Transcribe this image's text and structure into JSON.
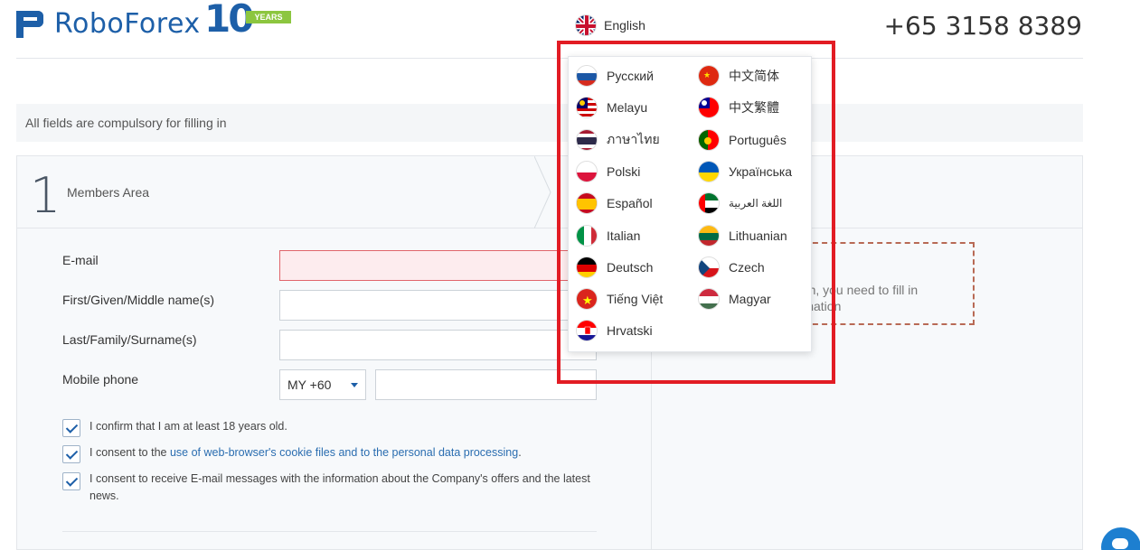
{
  "header": {
    "brand": "RoboForex",
    "anniversary_number": "10",
    "anniversary_label": "YEARS",
    "language_current": "English",
    "phone": "+65 3158 8389"
  },
  "notice": "All fields are compulsory for filling in",
  "step": {
    "number": "1",
    "label": "Members Area"
  },
  "form": {
    "email_label": "E-mail",
    "first_name_label": "First/Given/Middle name(s)",
    "last_name_label": "Last/Family/Surname(s)",
    "mobile_label": "Mobile phone",
    "country_code": "MY +60"
  },
  "checkboxes": [
    {
      "text": "I confirm that I am at least 18 years old.",
      "checked": true
    },
    {
      "prefix": "I consent to the ",
      "link": "use of web-browser's cookie files and to the personal data processing",
      "suffix": ".",
      "checked": true
    },
    {
      "text": "I consent to receive E-mail messages with the information about the Company's offers and the latest news.",
      "checked": true
    }
  ],
  "info": {
    "line1": "ation, you need to fill in",
    "line2": "formation"
  },
  "languages": [
    {
      "label": "Русский",
      "flag": "ru-flag-icon"
    },
    {
      "label": "中文简体",
      "flag": "cn-flag-icon"
    },
    {
      "label": "Melayu",
      "flag": "my-flag-icon"
    },
    {
      "label": "中文繁體",
      "flag": "tw-flag-icon"
    },
    {
      "label": "ภาษาไทย",
      "flag": "th-flag-icon"
    },
    {
      "label": "Português",
      "flag": "pt-flag-icon"
    },
    {
      "label": "Polski",
      "flag": "pl-flag-icon"
    },
    {
      "label": "Українська",
      "flag": "ua-flag-icon"
    },
    {
      "label": "Español",
      "flag": "es-flag-icon"
    },
    {
      "label": "اللغة العربية",
      "flag": "ae-flag-icon"
    },
    {
      "label": "Italian",
      "flag": "it-flag-icon"
    },
    {
      "label": "Lithuanian",
      "flag": "lt-flag-icon"
    },
    {
      "label": "Deutsch",
      "flag": "de-flag-icon"
    },
    {
      "label": "Czech",
      "flag": "cz-flag-icon"
    },
    {
      "label": "Tiếng Việt",
      "flag": "vn-flag-icon"
    },
    {
      "label": "Magyar",
      "flag": "hu-flag-icon"
    },
    {
      "label": "Hrvatski",
      "flag": "hr-flag-icon"
    }
  ],
  "colors": {
    "brand": "#1d5fa8",
    "accent_green": "#8cc63f",
    "highlight": "#e21c24",
    "error_field": "#fdecee"
  }
}
